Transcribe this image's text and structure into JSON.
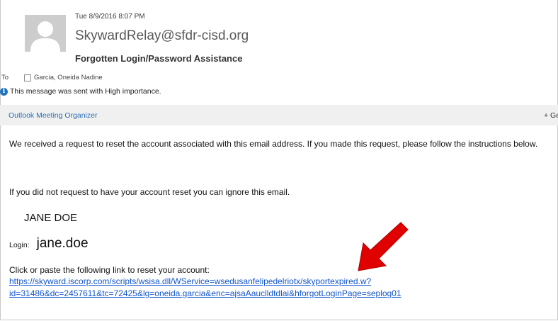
{
  "header": {
    "date": "Tue 8/9/2016 8:07 PM",
    "sender": "SkywardRelay@sfdr-cisd.org",
    "subject": "Forgotten Login/Password Assistance",
    "to_label": "To",
    "to_recipient": "Garcia, Oneida Nadine",
    "importance_text": "This message was sent with High importance."
  },
  "addin_bar": {
    "left_label": "Outlook Meeting Organizer",
    "right_label": "+ Get"
  },
  "body": {
    "paragraph1": "We received a request to reset the account associated with this email address.  If you made this request, please follow the instructions below.",
    "paragraph2": "If you did not request to have your account reset you can ignore this email.",
    "name": "JANE DOE",
    "login_label": "Login:",
    "login_value": "jane.doe",
    "link_intro": "Click or paste the following link to reset your account:",
    "link_url": "https://skyward.iscorp.com/scripts/wsisa.dll/WService=wsedusanfelipedelriotx/skyportexpired.w?id=31486&dc=2457611&tc=72425&lg=oneida.garcia&enc=ajsaAauclldtdlai&hforgotLoginPage=seplog01"
  },
  "colors": {
    "link": "#1155cc",
    "info_icon": "#1e73be",
    "arrow": "#e00000"
  },
  "icons": [
    "avatar-placeholder",
    "info-icon",
    "checkbox-icon",
    "red-arrow-annotation"
  ]
}
